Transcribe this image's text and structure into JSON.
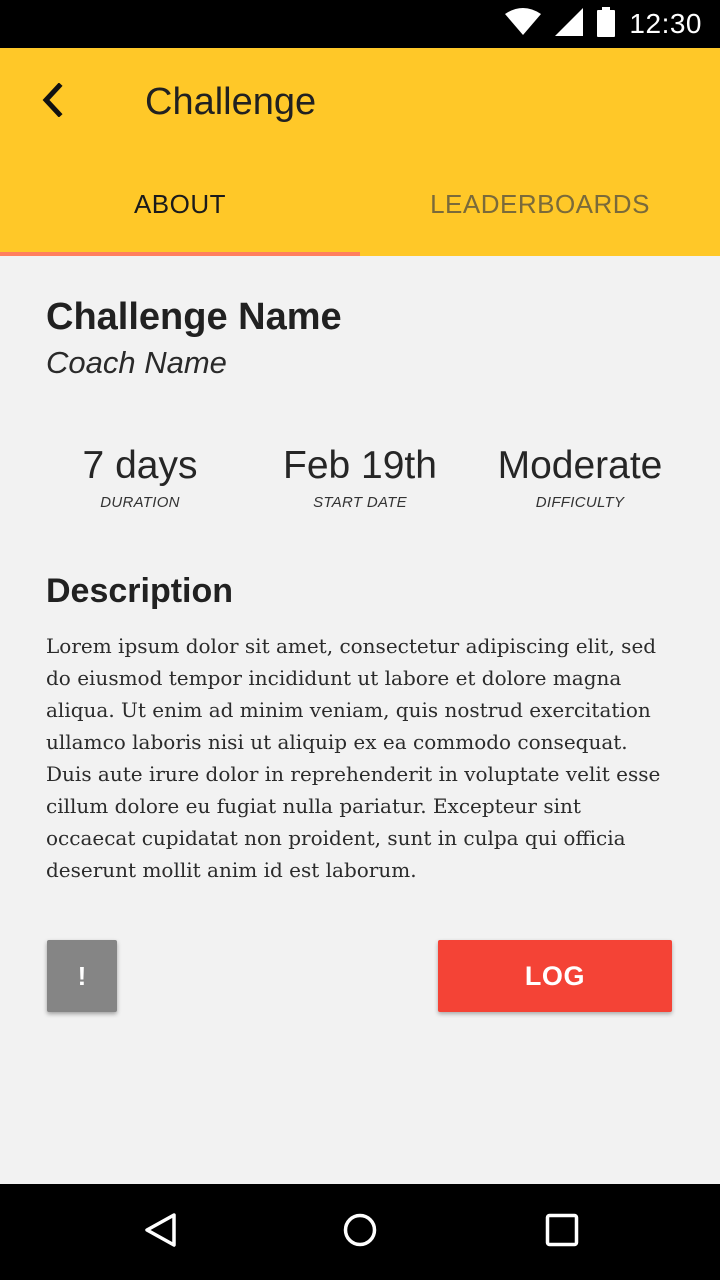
{
  "status_bar": {
    "time": "12:30",
    "icons": [
      "wifi-icon",
      "cell-signal-icon",
      "battery-icon"
    ]
  },
  "app_bar": {
    "title": "Challenge",
    "back_icon": "chevron-left-icon",
    "color": "#ffc828"
  },
  "tabs": [
    {
      "label": "ABOUT",
      "active": true
    },
    {
      "label": "LEADERBOARDS",
      "active": false
    }
  ],
  "challenge": {
    "name": "Challenge Name",
    "coach": "Coach Name"
  },
  "stats": [
    {
      "value": "7 days",
      "label": "DURATION"
    },
    {
      "value": "Feb 19th",
      "label": "START DATE"
    },
    {
      "value": "Moderate",
      "label": "DIFFICULTY"
    }
  ],
  "description": {
    "heading": "Description",
    "body": "Lorem ipsum dolor sit amet, consectetur adipiscing elit, sed do eiusmod tempor incididunt ut labore et dolore magna aliqua. Ut enim ad minim veniam, quis nostrud exercitation ullamco laboris nisi ut aliquip ex ea commodo consequat. Duis aute irure dolor in reprehenderit in voluptate velit esse cillum dolore eu fugiat nulla pariatur. Excepteur sint occaecat cupidatat non proident, sunt in culpa qui officia deserunt mollit anim id est laborum."
  },
  "actions": {
    "report_label": "!",
    "log_label": "LOG",
    "log_color": "#f44336"
  },
  "nav_bar": {
    "icons": [
      "back-triangle-icon",
      "home-circle-icon",
      "recents-square-icon"
    ]
  }
}
